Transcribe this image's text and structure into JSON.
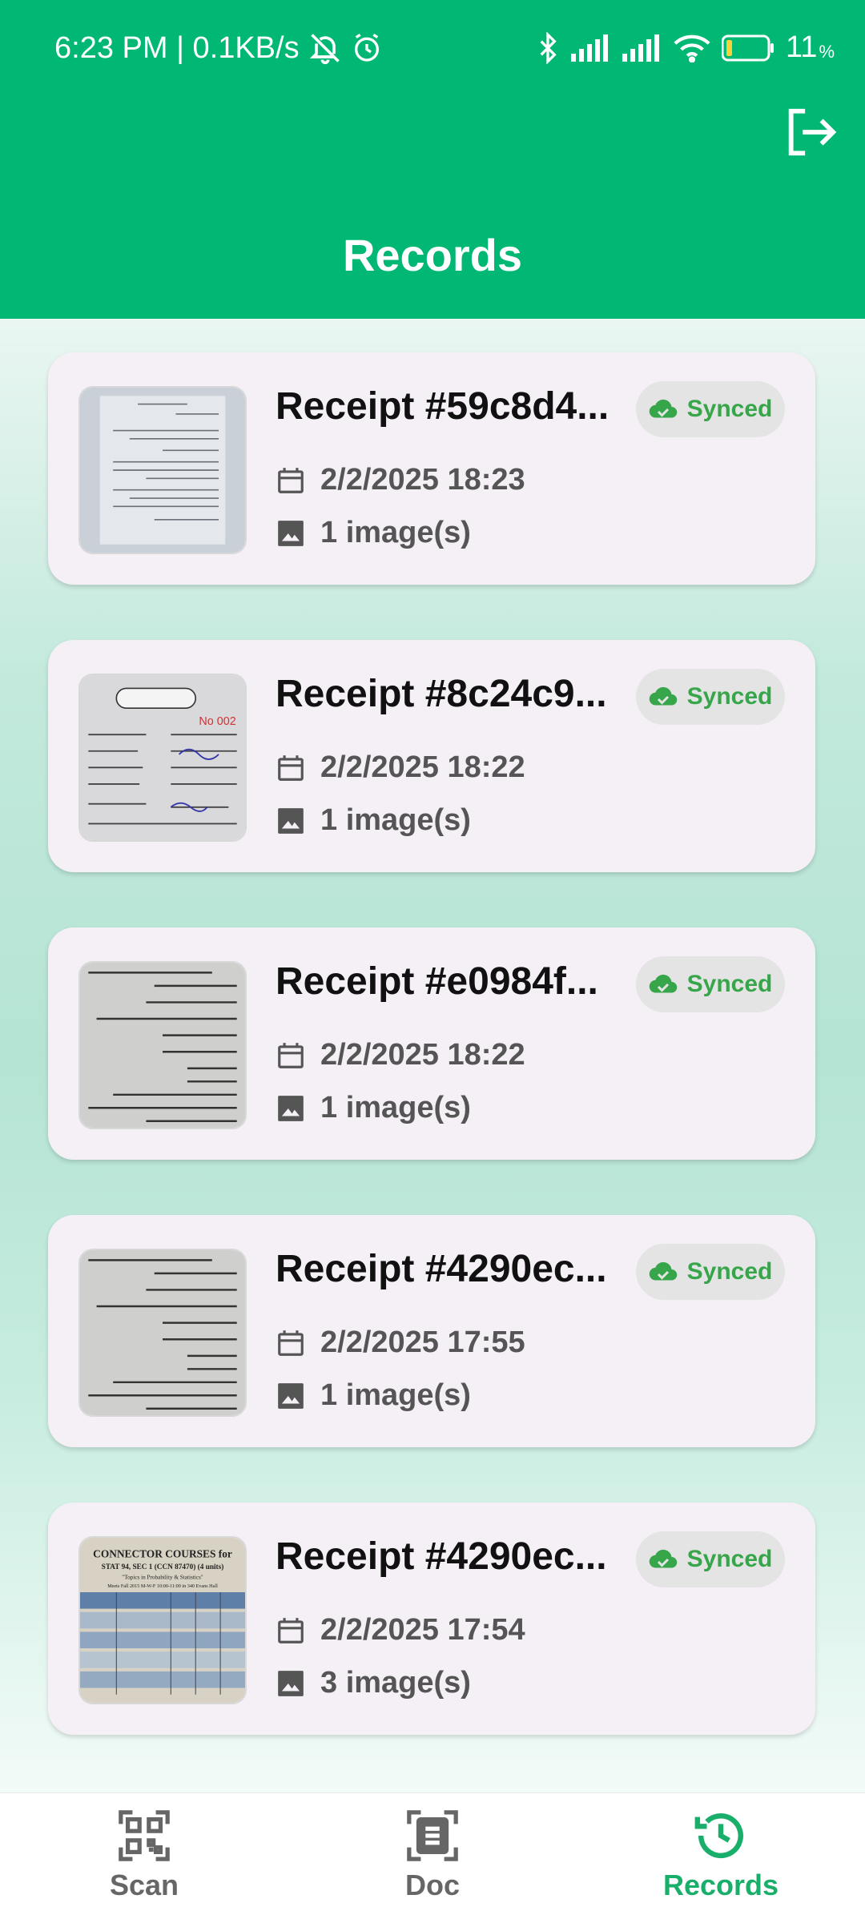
{
  "status_bar": {
    "time_speed": "6:23 PM | 0.1KB/s",
    "battery_percent": "11"
  },
  "header": {
    "title": "Records"
  },
  "records": [
    {
      "title": "Receipt #59c8d4...",
      "status": "Synced",
      "date": "2/2/2025 18:23",
      "images": "1 image(s)"
    },
    {
      "title": "Receipt #8c24c9...",
      "status": "Synced",
      "date": "2/2/2025 18:22",
      "images": "1 image(s)"
    },
    {
      "title": "Receipt #e0984f...",
      "status": "Synced",
      "date": "2/2/2025 18:22",
      "images": "1 image(s)"
    },
    {
      "title": "Receipt #4290ec...",
      "status": "Synced",
      "date": "2/2/2025 17:55",
      "images": "1 image(s)"
    },
    {
      "title": "Receipt #4290ec...",
      "status": "Synced",
      "date": "2/2/2025 17:54",
      "images": "3 image(s)"
    }
  ],
  "thumbnail_texts": {
    "connector_line1": "CONNECTOR COURSES for",
    "connector_line2": "STAT 94, SEC 1 (CCN 87470) (4 units)",
    "connector_line3": "\"Topics in Probability & Statistics\"",
    "connector_line4": "Meets Fall 2015 M-W-F 10:00-11:00 in 340 Evans Hall",
    "receipt_no": "No 002"
  },
  "bottom_nav": {
    "items": [
      {
        "label": "Scan",
        "icon": "qr-scan-icon"
      },
      {
        "label": "Doc",
        "icon": "document-scan-icon"
      },
      {
        "label": "Records",
        "icon": "history-icon",
        "active": true
      }
    ]
  },
  "colors": {
    "primary": "#00b874",
    "active_nav": "#1aae6b",
    "synced_green": "#37a64a"
  }
}
